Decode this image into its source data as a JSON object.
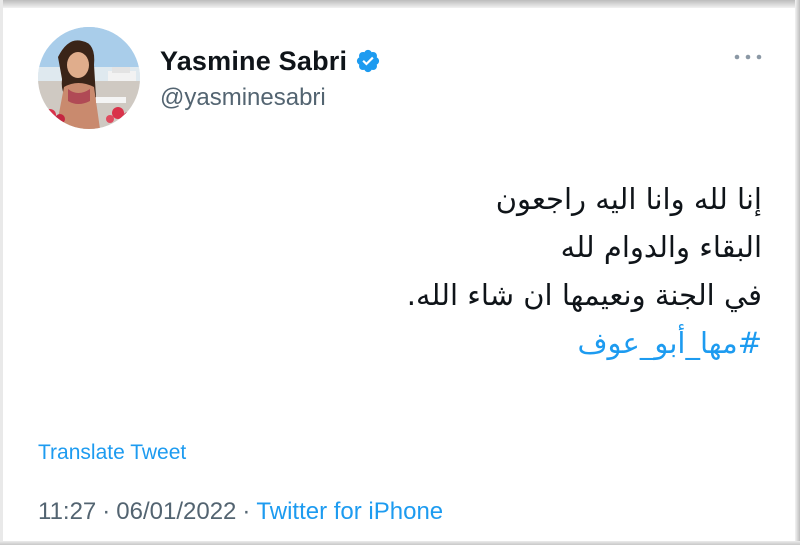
{
  "user": {
    "display_name": "Yasmine Sabri",
    "handle": "@yasminesabri",
    "verified": true,
    "avatar_icon": "profile-photo"
  },
  "tweet": {
    "lines": [
      "إنا لله وانا اليه راجعون",
      "البقاء والدوام لله",
      "في الجنة ونعيمها ان شاء الله."
    ],
    "hashtag": "#مها_أبو_عوف"
  },
  "actions": {
    "translate_label": "Translate Tweet",
    "more_icon": "more-options-icon"
  },
  "meta": {
    "time": "11:27",
    "separator": "·",
    "date": "06/01/2022",
    "source": "Twitter for iPhone"
  },
  "colors": {
    "accent": "#1d9bf0",
    "text_primary": "#0f1419",
    "text_secondary": "#536471"
  }
}
